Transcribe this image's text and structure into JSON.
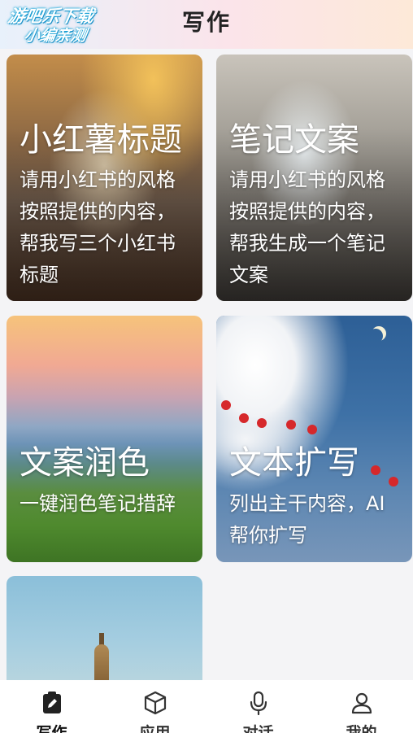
{
  "header": {
    "title": "写作",
    "watermark_line1": "游吧乐下载",
    "watermark_line2": "小编亲测"
  },
  "cards": [
    {
      "title": "小红薯标题",
      "desc": "请用小红书的风格按照提供的内容，帮我写三个小红书标题"
    },
    {
      "title": "笔记文案",
      "desc": "请用小红书的风格按照提供的内容，帮我生成一个笔记文案"
    },
    {
      "title": "文案润色",
      "desc": "一键润色笔记措辞"
    },
    {
      "title": "文本扩写",
      "desc": "列出主干内容，AI帮你扩写"
    },
    {
      "title": "",
      "desc": ""
    }
  ],
  "tabbar": {
    "tabs": [
      {
        "label": "写作",
        "icon": "edit-document-icon",
        "active": true
      },
      {
        "label": "应用",
        "icon": "cube-icon"
      },
      {
        "label": "对话",
        "icon": "microphone-icon"
      },
      {
        "label": "我的",
        "icon": "user-icon"
      }
    ]
  }
}
